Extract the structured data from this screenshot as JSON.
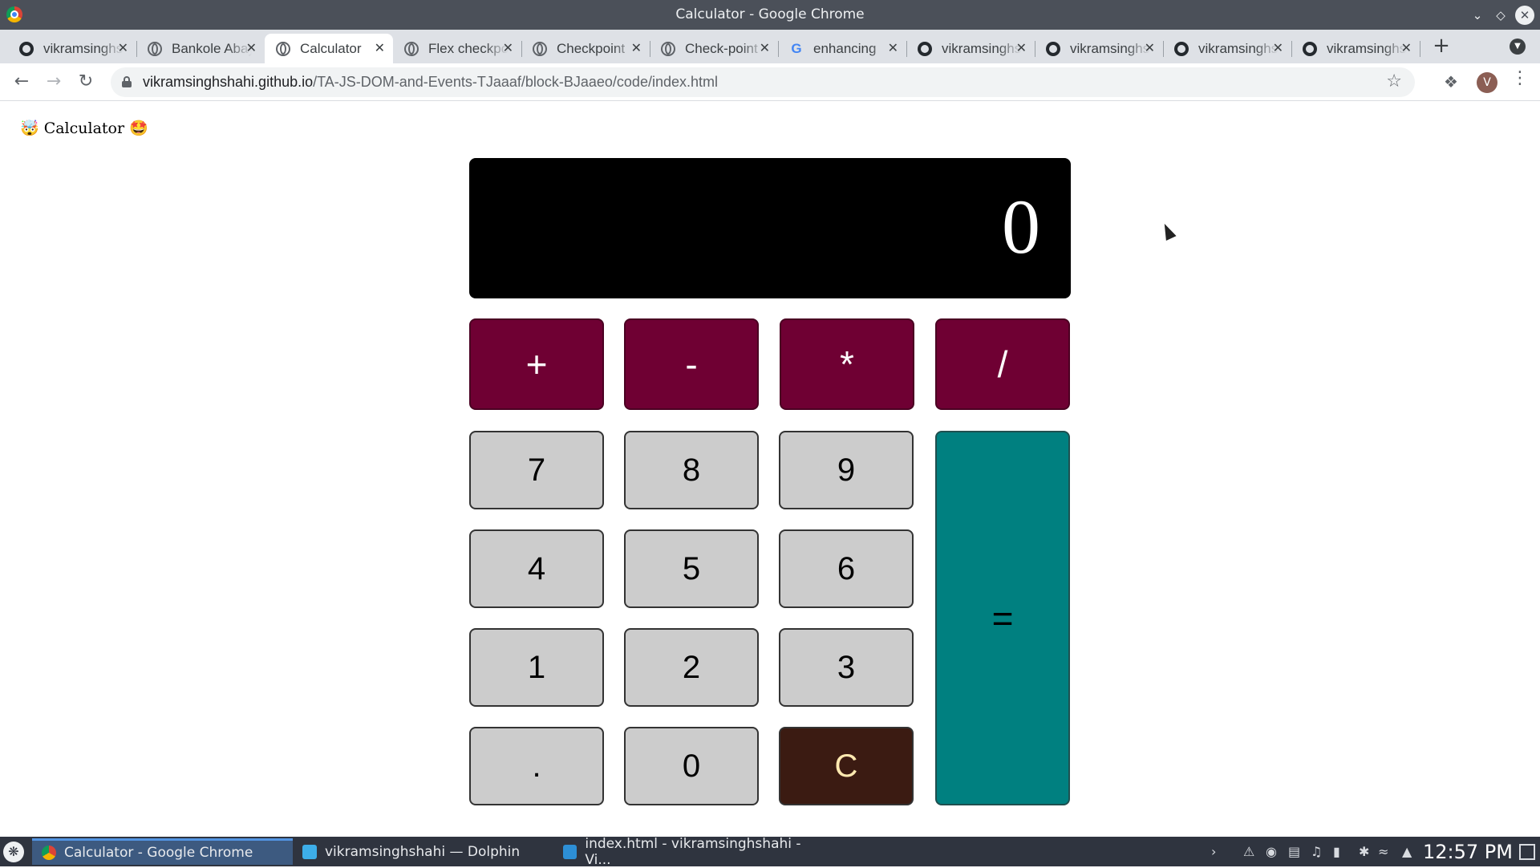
{
  "window": {
    "title": "Calculator - Google Chrome"
  },
  "tabs": [
    {
      "label": "vikramsinghshahi",
      "icon": "github-icon",
      "active": false
    },
    {
      "label": "Bankole Abayomi",
      "icon": "globe-icon",
      "active": false
    },
    {
      "label": "Calculator",
      "icon": "globe-icon",
      "active": true
    },
    {
      "label": "Flex checkpoint",
      "icon": "globe-icon",
      "active": false
    },
    {
      "label": "Checkpoint",
      "icon": "globe-icon",
      "active": false
    },
    {
      "label": "Check-point",
      "icon": "globe-icon",
      "active": false
    },
    {
      "label": "enhancing",
      "icon": "google-icon",
      "active": false
    },
    {
      "label": "vikramsinghshahi",
      "icon": "github-icon",
      "active": false
    },
    {
      "label": "vikramsinghshahi",
      "icon": "github-icon",
      "active": false
    },
    {
      "label": "vikramsinghshahi",
      "icon": "github-icon",
      "active": false
    },
    {
      "label": "vikramsinghshahi",
      "icon": "github-icon",
      "active": false
    }
  ],
  "toolbar": {
    "url_host": "vikramsinghshahi.github.io",
    "url_path": "/TA-JS-DOM-and-Events-TJaaaf/block-BJaaeo/code/index.html",
    "avatar_letter": "V"
  },
  "page": {
    "heading": "🤯 Calculator 🤩",
    "display_value": "0",
    "operators": [
      "+",
      "-",
      "*",
      "/"
    ],
    "digits_row1": [
      "7",
      "8",
      "9"
    ],
    "digits_row2": [
      "4",
      "5",
      "6"
    ],
    "digits_row3": [
      "1",
      "2",
      "3"
    ],
    "bottom_row": [
      ".",
      "0",
      "C"
    ],
    "equals": "=",
    "colors": {
      "operator": "#6f0033",
      "number": "#cccccc",
      "clear": "#3b1b12",
      "equals": "#008080",
      "display": "#000000"
    }
  },
  "taskbar": {
    "tasks": [
      {
        "label": "Calculator - Google Chrome",
        "icon": "chrome-icon",
        "active": true
      },
      {
        "label": "vikramsinghshahi — Dolphin",
        "icon": "folder-icon",
        "active": false
      },
      {
        "label": "index.html - vikramsinghshahi - Vi...",
        "icon": "vscode-icon",
        "active": false
      }
    ],
    "clock": "12:57 PM"
  }
}
